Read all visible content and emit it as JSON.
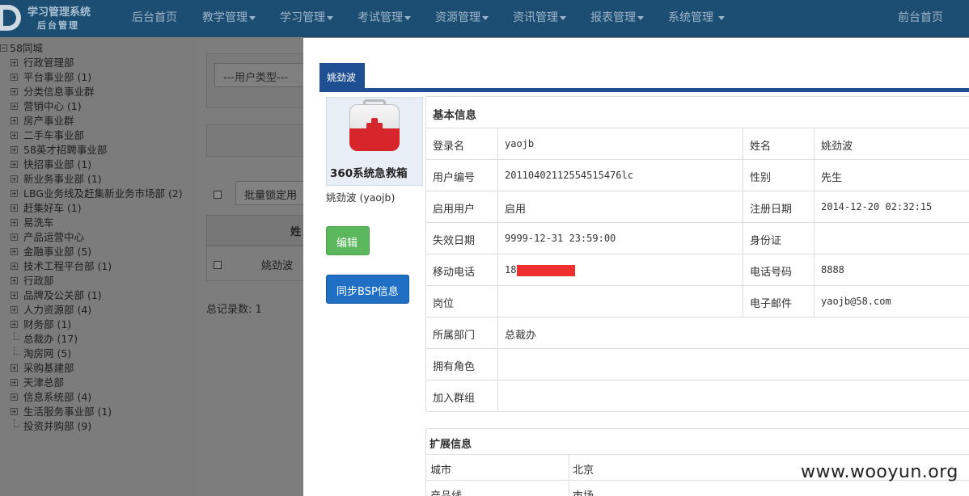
{
  "brand": {
    "title": "学习管理系统",
    "subtitle": "后台管理"
  },
  "nav": {
    "items": [
      {
        "label": "后台首页",
        "dropdown": false
      },
      {
        "label": "教学管理",
        "dropdown": true
      },
      {
        "label": "学习管理",
        "dropdown": true
      },
      {
        "label": "考试管理",
        "dropdown": true
      },
      {
        "label": "资源管理",
        "dropdown": true
      },
      {
        "label": "资讯管理",
        "dropdown": true
      },
      {
        "label": "报表管理",
        "dropdown": true
      },
      {
        "label": "系统管理",
        "dropdown": true
      }
    ],
    "right_link": "前台首页"
  },
  "tree": {
    "root": "58同城",
    "items": [
      {
        "label": "行政管理部",
        "expandable": true
      },
      {
        "label": "平台事业部 (1)",
        "expandable": true
      },
      {
        "label": "分类信息事业群",
        "expandable": true
      },
      {
        "label": "营销中心 (1)",
        "expandable": true
      },
      {
        "label": "房产事业群",
        "expandable": true
      },
      {
        "label": "二手车事业部",
        "expandable": true
      },
      {
        "label": "58英才招聘事业部",
        "expandable": true
      },
      {
        "label": "快招事业部 (1)",
        "expandable": true
      },
      {
        "label": "新业务事业部 (1)",
        "expandable": true
      },
      {
        "label": "LBG业务线及赶集新业务市场部 (2)",
        "expandable": true
      },
      {
        "label": "赶集好车 (1)",
        "expandable": true
      },
      {
        "label": "易洗车",
        "expandable": true
      },
      {
        "label": "产品运营中心",
        "expandable": true
      },
      {
        "label": "金融事业部 (5)",
        "expandable": true
      },
      {
        "label": "技术工程平台部 (1)",
        "expandable": true
      },
      {
        "label": "行政部",
        "expandable": true
      },
      {
        "label": "品牌及公关部 (1)",
        "expandable": true
      },
      {
        "label": "人力资源部 (4)",
        "expandable": true
      },
      {
        "label": "财务部 (1)",
        "expandable": true
      },
      {
        "label": "总裁办 (17)",
        "expandable": false
      },
      {
        "label": "淘房网 (5)",
        "expandable": false
      },
      {
        "label": "采购基建部",
        "expandable": true
      },
      {
        "label": "天津总部",
        "expandable": true
      },
      {
        "label": "信息系统部 (4)",
        "expandable": true
      },
      {
        "label": "生活服务事业部 (1)",
        "expandable": true
      },
      {
        "label": "投资并购部 (9)",
        "expandable": false
      }
    ]
  },
  "background": {
    "user_type_select": "---用户类型---",
    "batch_lock_button": "批量锁定用",
    "table_header": "姓",
    "row_name": "姚劲波",
    "total": "总记录数: 1"
  },
  "modal": {
    "tab": "姚劲波",
    "profile_image_text": "360系统急救箱",
    "profile_name": "姚劲波 (yaojb)",
    "edit_button": "编辑",
    "sync_button": "同步BSP信息",
    "basic_title": "基本信息",
    "rows": [
      {
        "l1": "登录名",
        "v1": "yaojb",
        "l2": "姓名",
        "v2": "姚劲波"
      },
      {
        "l1": "用户编号",
        "v1": "20110402112554515476lc",
        "l2": "性别",
        "v2": "先生"
      },
      {
        "l1": "启用用户",
        "v1": "启用",
        "l2": "注册日期",
        "v2": "2014-12-20 02:32:15"
      },
      {
        "l1": "失效日期",
        "v1": "9999-12-31 23:59:00",
        "l2": "身份证",
        "v2": ""
      },
      {
        "l1": "移动电话",
        "v1": "18",
        "l2": "电话号码",
        "v2": "8888"
      },
      {
        "l1": "岗位",
        "v1": "",
        "l2": "电子邮件",
        "v2": "yaojb@58.com"
      }
    ],
    "wide_rows": [
      {
        "label": "所属部门",
        "value": "总裁办"
      },
      {
        "label": "拥有角色",
        "value": ""
      },
      {
        "label": "加入群组",
        "value": ""
      }
    ],
    "ext_title": "扩展信息",
    "ext_rows": [
      {
        "label": "城市",
        "value": "北京"
      },
      {
        "label": "产品线",
        "value": "市场"
      }
    ]
  },
  "watermark": "www.wooyun.org",
  "colors": {
    "nav_bg": "#1b4e72",
    "tab_blue": "#1e4f92",
    "edit_green": "#5cb85c",
    "sync_blue": "#1f6fc5",
    "redaction": "#f03030"
  }
}
